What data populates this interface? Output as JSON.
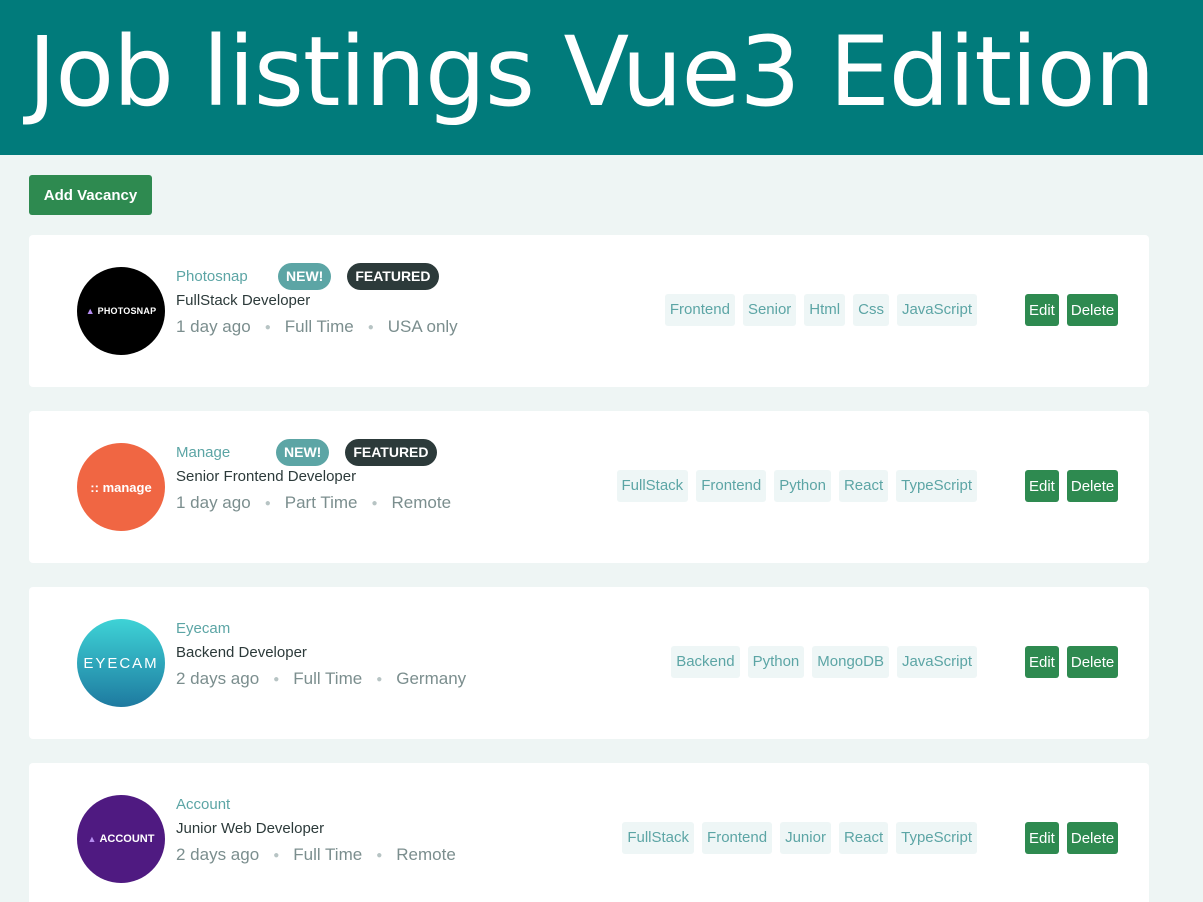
{
  "header": {
    "title": "Job listings Vue3 Edition",
    "background": "#017b7b"
  },
  "toolbar": {
    "add_label": "Add Vacancy"
  },
  "colors": {
    "accent": "#5ca5a5",
    "button": "#2e8a50",
    "featured": "#2c3a3a",
    "page": "#eef5f4"
  },
  "jobs": [
    {
      "company": "Photosnap",
      "logo_text": "PHOTOSNAP",
      "logo_color": "#000000",
      "new_label": "NEW!",
      "featured_label": "FEATURED",
      "position": "FullStack Developer",
      "posted": "1 day ago",
      "contract": "Full Time",
      "location": "USA only",
      "tags": [
        "Frontend",
        "Senior",
        "Html",
        "Css",
        "JavaScript"
      ],
      "edit_label": "Edit",
      "delete_label": "Delete"
    },
    {
      "company": "Manage",
      "logo_text": ":: manage",
      "logo_color": "#f06643",
      "new_label": "NEW!",
      "featured_label": "FEATURED",
      "position": "Senior Frontend Developer",
      "posted": "1 day ago",
      "contract": "Part Time",
      "location": "Remote",
      "tags": [
        "FullStack",
        "Frontend",
        "Python",
        "React",
        "TypeScript"
      ],
      "edit_label": "Edit",
      "delete_label": "Delete"
    },
    {
      "company": "Eyecam",
      "logo_text": "EYECAM",
      "logo_color": "#2aa6b9",
      "position": "Backend Developer",
      "posted": "2 days ago",
      "contract": "Full Time",
      "location": "Germany",
      "tags": [
        "Backend",
        "Python",
        "MongoDB",
        "JavaScript"
      ],
      "edit_label": "Edit",
      "delete_label": "Delete"
    },
    {
      "company": "Account",
      "logo_text": "ACCOUNT",
      "logo_color": "#4f1a81",
      "position": "Junior Web Developer",
      "posted": "2 days ago",
      "contract": "Full Time",
      "location": "Remote",
      "tags": [
        "FullStack",
        "Frontend",
        "Junior",
        "React",
        "TypeScript"
      ],
      "edit_label": "Edit",
      "delete_label": "Delete"
    }
  ]
}
